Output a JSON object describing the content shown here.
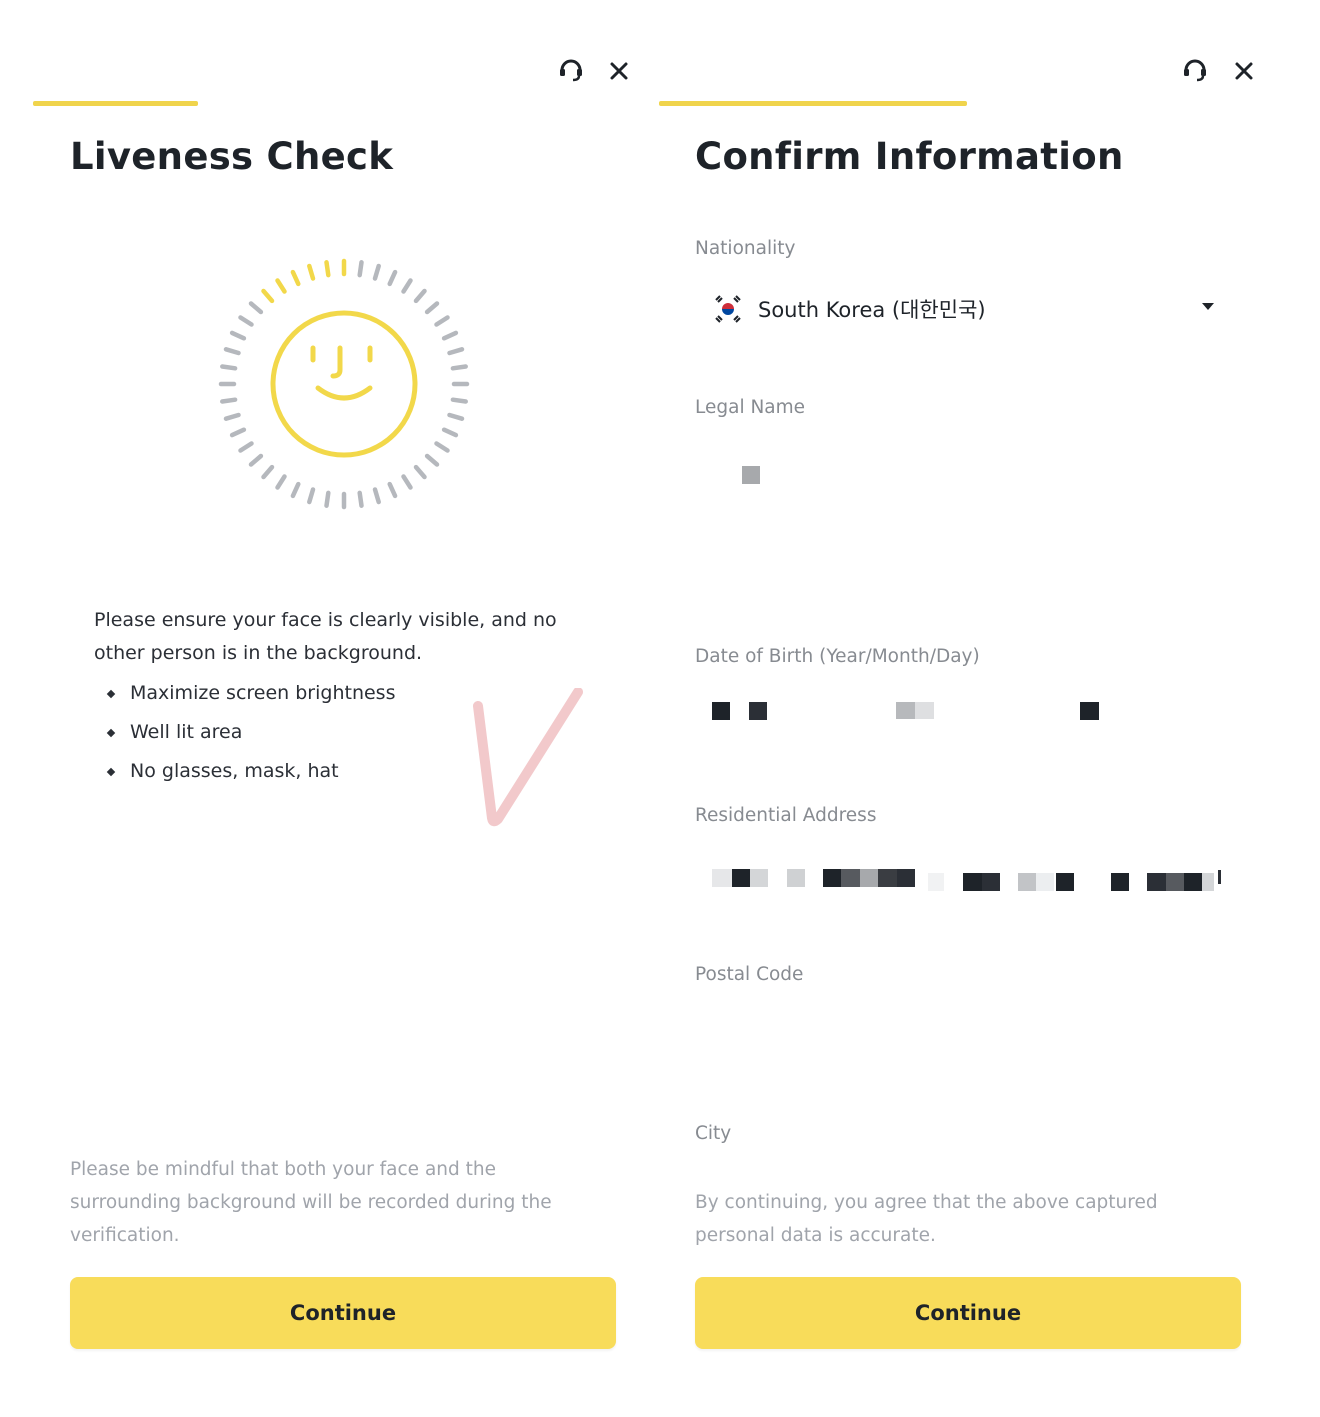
{
  "liveness": {
    "title": "Liveness Check",
    "instruction": "Please ensure your face is clearly visible, and no other person is in the background.",
    "bullets": [
      "Maximize screen brightness",
      "Well lit area",
      "No glasses, mask, hat"
    ],
    "notice": "Please be mindful that both your face and the surrounding background will be recorded during the verification.",
    "continue_label": "Continue"
  },
  "confirm": {
    "title": "Confirm Information",
    "nationality_label": "Nationality",
    "nationality_value": "South Korea (대한민국)",
    "legal_name_label": "Legal Name",
    "dob_label": "Date of Birth (Year/Month/Day)",
    "address_label": "Residential Address",
    "postal_code_label": "Postal Code",
    "city_label": "City",
    "notice": "By continuing, you agree that the above captured personal data is accurate.",
    "continue_label": "Continue"
  },
  "icons": {
    "support": "headset-icon",
    "close": "close-icon",
    "flag": "south-korea-flag-icon",
    "dropdown": "chevron-down-icon",
    "face": "smiley-face-icon",
    "check": "check-mark-icon"
  },
  "colors": {
    "accent_yellow": "#f8dc5a",
    "progress_yellow": "#f0d44c",
    "text_dark": "#1e2329",
    "label_gray": "#878b91",
    "muted_gray": "#a0a4ab",
    "check_pink": "#f2c9cb"
  }
}
